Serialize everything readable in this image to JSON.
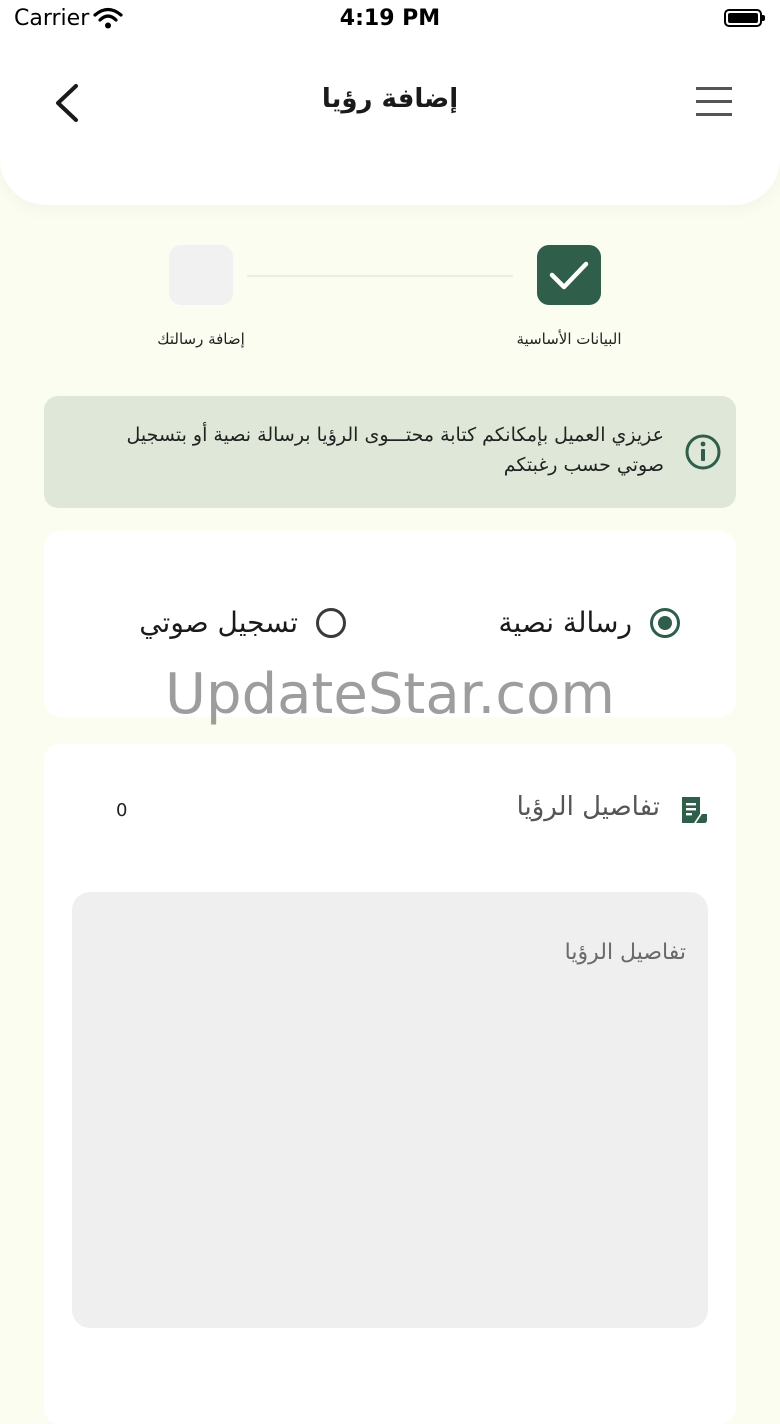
{
  "status_bar": {
    "carrier": "Carrier",
    "time": "4:19 PM"
  },
  "header": {
    "title": "إضافة رؤيا"
  },
  "stepper": {
    "steps": [
      {
        "label": "البيانات الأساسية",
        "state": "done"
      },
      {
        "label": "إضافة رسالتك",
        "state": "pending"
      }
    ]
  },
  "info_banner": {
    "text": "عزيزي العميل بإمكانكم كتابة محتـــوى الرؤيا برسالة نصية أو بتسجيل صوتي حسب رغبتكم"
  },
  "message_type": {
    "options": [
      {
        "label": "رسالة نصية",
        "selected": true
      },
      {
        "label": "تسجيل صوتي",
        "selected": false
      }
    ]
  },
  "watermark": "UpdateStar.com",
  "details": {
    "title": "تفاصيل الرؤيا",
    "char_count": "0",
    "input_value": "",
    "placeholder": "تفاصيل الرؤيا"
  },
  "colors": {
    "primary": "#2f5e4a",
    "background": "#fcfdf1",
    "banner": "#dfe8d8",
    "input_bg": "#efefef"
  }
}
